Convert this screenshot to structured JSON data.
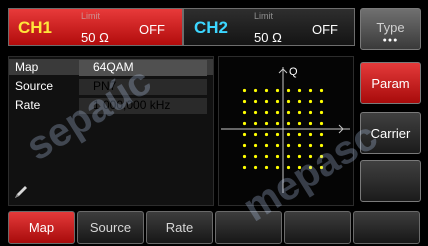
{
  "channels": [
    {
      "name": "CH1",
      "limit": "Limit",
      "load": "50 Ω",
      "state": "OFF",
      "accent": "#ffe63a",
      "bg": "#c81e1e"
    },
    {
      "name": "CH2",
      "limit": "Limit",
      "load": "50 Ω",
      "state": "OFF",
      "accent": "#3cd6ff",
      "bg": "#1e1e1e"
    }
  ],
  "params": [
    {
      "label": "Map",
      "value": "64QAM",
      "selected": true
    },
    {
      "label": "Source",
      "value": "PN7"
    },
    {
      "label": "Rate",
      "value": "1 000,000 kHz"
    }
  ],
  "right_keys": [
    {
      "label": "Type",
      "indicator": "●●●"
    },
    {
      "label": "Param",
      "active": true
    },
    {
      "label": "Carrier"
    },
    {
      "label": ""
    }
  ],
  "bottom_keys": [
    {
      "label": "Map",
      "active": true
    },
    {
      "label": "Source"
    },
    {
      "label": "Rate"
    },
    {
      "label": ""
    },
    {
      "label": ""
    },
    {
      "label": ""
    }
  ],
  "constellation": {
    "modulation": "64QAM",
    "axis_label": "Q",
    "points_per_side": 8,
    "point_color": "#ffff00"
  },
  "accent_color": "#d61f1f"
}
